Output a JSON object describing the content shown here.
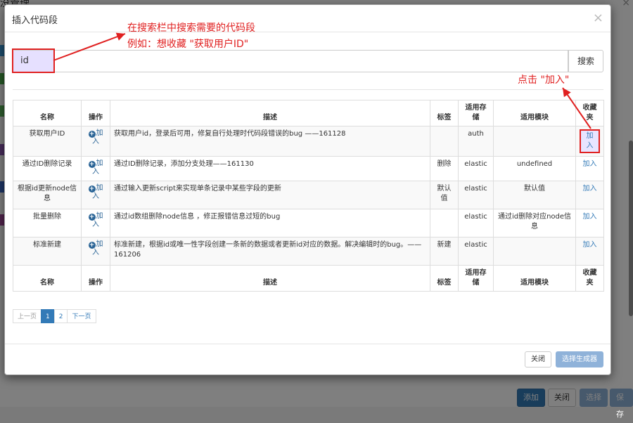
{
  "background": {
    "title_fragment": "没管理",
    "close_char": "×",
    "footer_buttons": [
      "添加",
      "关闭",
      "选择",
      "保存"
    ]
  },
  "modal": {
    "title": "插入代码段",
    "close_char": "×",
    "search": {
      "value": "id",
      "button_label": "搜索"
    },
    "table": {
      "headers": [
        "名称",
        "操作",
        "描述",
        "标签",
        "适用存储",
        "适用模块",
        "收藏夹"
      ],
      "add_op_label": "加入",
      "fav_label": "加入",
      "rows": [
        {
          "name": "获取用户ID",
          "desc": "获取用户id，登录后可用，修复自行处理时代码段错误的bug ——161128",
          "tag": "",
          "storage": "auth",
          "module": ""
        },
        {
          "name": "通过ID删除记录",
          "desc": "通过ID删除记录，添加分支处理——161130",
          "tag": "删除",
          "storage": "elastic",
          "module": "undefined"
        },
        {
          "name": "根据id更新node信息",
          "desc": "通过输入更新script来实现单条记录中某些字段的更新",
          "tag": "默认值",
          "storage": "elastic",
          "module": "默认值"
        },
        {
          "name": "批量删除",
          "desc": "通过id数组删除node信息 ，修正报错信息过短的bug",
          "tag": "",
          "storage": "elastic",
          "module": "通过id删除对应node信息"
        },
        {
          "name": "标准新建",
          "desc": "标准新建，根据id或唯一性字段创建一条新的数据或者更新id对应的数据。解决编辑时的bug。——161206",
          "tag": "新建",
          "storage": "elastic",
          "module": ""
        }
      ]
    },
    "pagination": {
      "prev": "上一页",
      "pages": [
        "1",
        "2"
      ],
      "active": "1",
      "next": "下一页"
    },
    "footer": {
      "close_label": "关闭",
      "generate_label": "选择生成器"
    }
  },
  "annotations": {
    "line1": "在搜索栏中搜索需要的代码段",
    "line2": "例如：想收藏 \"获取用户ID\"",
    "click_hint": "点击 \"加入\""
  },
  "colors": {
    "annotation_red": "#e02020",
    "primary": "#337ab7",
    "disabled_primary": "#8fb2d9",
    "highlight_fill": "#e6e0ff"
  }
}
